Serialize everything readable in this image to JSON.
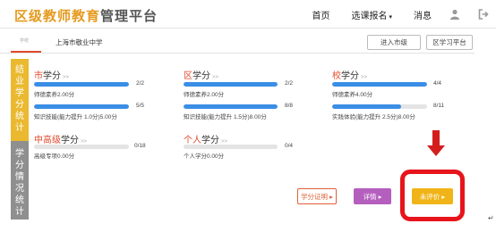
{
  "header": {
    "logo_highlight": "区级教师教育",
    "logo_rest": "管理平台",
    "nav": [
      "首页",
      "选课报名",
      "消息"
    ],
    "nav_caret": "▾",
    "user_icon": "user-icon",
    "logout_icon": "logout-icon"
  },
  "subheader": {
    "tab_tag": "学校",
    "school_name": "上海市敬业中学",
    "btn_city": "进入市级",
    "btn_platform": "区学习平台"
  },
  "sidebar": {
    "section1": [
      "结",
      "业",
      "学",
      "分",
      "统",
      "计"
    ],
    "section2": [
      "学",
      "分",
      "情",
      "况",
      "统",
      "计"
    ]
  },
  "cards": {
    "city": {
      "title_hl": "市",
      "title_rest": "学分",
      "dots": ">>",
      "rows": [
        {
          "label": "师德素养2.00分",
          "frac": "2/2",
          "progress": 1.0
        },
        {
          "label": "知识技能(能力提升 1.0分)5.00分",
          "frac": "5/5",
          "progress": 1.0
        }
      ]
    },
    "district": {
      "title_hl": "区",
      "title_rest": "学分",
      "dots": ">>",
      "rows": [
        {
          "label": "师德素养2.00分",
          "frac": "2/2",
          "progress": 1.0
        },
        {
          "label": "知识技能(能力提升 1.5分)8.00分",
          "frac": "8/8",
          "progress": 1.0
        }
      ]
    },
    "school": {
      "title_hl": "校",
      "title_rest": "学分",
      "dots": ">>",
      "rows": [
        {
          "label": "师德素养4.00分",
          "frac": "4/4",
          "progress": 1.0
        },
        {
          "label": "实践体验(能力提升 2.5分)8.00分",
          "frac": "8/11",
          "progress": 0.727
        }
      ]
    },
    "senior": {
      "title_hl": "中高级",
      "title_rest": "学分",
      "dots": ">>",
      "rows": [
        {
          "label": "高级专项0.00分",
          "frac": "0/18",
          "progress": 0
        }
      ]
    },
    "personal": {
      "title_hl": "个人",
      "title_rest": "学分",
      "dots": ">>",
      "rows": [
        {
          "label": "个人学分0.00分",
          "frac": "0/4",
          "progress": 0
        }
      ]
    }
  },
  "actions": {
    "cert": "学分证明 ▸",
    "detail": "详情 ▸",
    "evaluate": "未评价 ▸"
  },
  "annotation": {
    "return_mark": "↵"
  },
  "colors": {
    "accent": "#e59a1f",
    "progress": "#3a8ee6",
    "highlight": "#e0492b",
    "sidebar_active": "#eab930",
    "sidebar_inactive": "#8f8f8f",
    "annotation": "#e8141b"
  }
}
